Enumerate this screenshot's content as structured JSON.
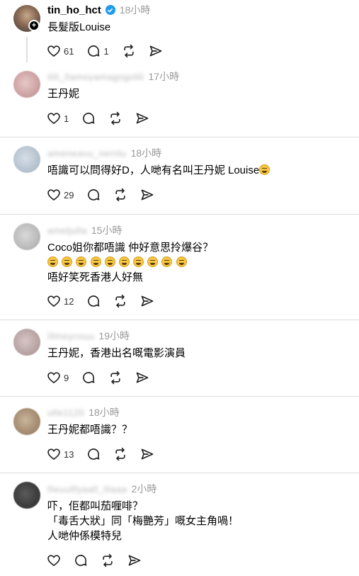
{
  "original_post": {
    "username": "tin_ho_hct",
    "time": "18小時",
    "text": "長髮版Louise",
    "likes": "61",
    "replies": "1"
  },
  "replies": [
    {
      "username_blurred": "ilili_llamoyamagogolili",
      "time": "17小時",
      "lines": [
        "王丹妮"
      ],
      "likes": "1"
    },
    {
      "username_blurred": "ameneavu_nernlu",
      "time": "18小時",
      "lines": [
        "唔識可以問得好D，人哋有名叫王丹妮 Louise"
      ],
      "likes": "29"
    },
    {
      "username_blurred": "ameljulla",
      "time": "15小時",
      "lines": [
        "Coco姐你都唔識 仲好意思拎爆谷？",
        "唔好笑死香港人好無"
      ],
      "likes": "12"
    },
    {
      "username_blurred": "illmeycouu",
      "time": "19小時",
      "lines": [
        "王丹妮，香港出名嘅電影演員"
      ],
      "likes": "9"
    },
    {
      "username_blurred": "ulle1120",
      "time": "18小時",
      "lines": [
        "王丹妮都唔識？？"
      ],
      "likes": "13"
    },
    {
      "username_blurred": "llwuulllyaall_lilaaa",
      "time": "2小時",
      "lines": [
        "吓，佢都叫茄喱啡？",
        "「毒舌大狀」同「梅艷芳」嘅女主角喎！",
        "人哋仲係模特兒"
      ],
      "likes": ""
    }
  ],
  "icons": {
    "like": "heart-icon",
    "reply": "comment-icon",
    "repost": "repost-icon",
    "share": "send-icon",
    "verified": "verified-badge-icon",
    "follow": "plus-icon",
    "laugh": "grinning-squinting-face-emoji",
    "grin": "grinning-face-emoji"
  },
  "colors": {
    "verified": "#1d9bf0",
    "time": "#999999",
    "divider": "#dcdcdc"
  }
}
